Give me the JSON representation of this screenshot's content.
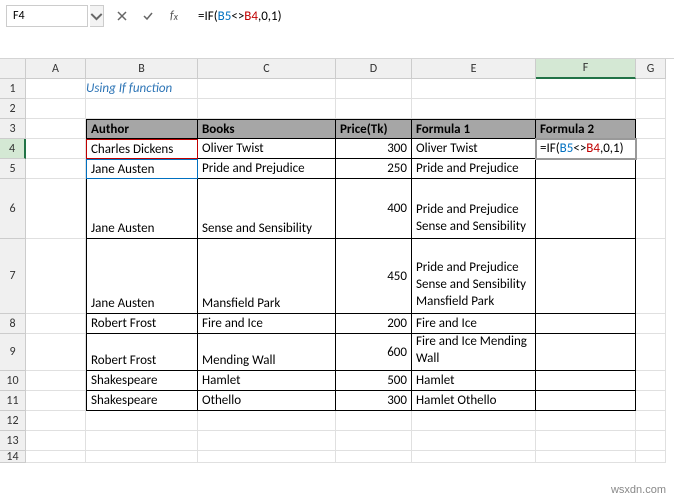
{
  "nameBox": "F4",
  "formula": "=IF(B5<>B4,0,1)",
  "formula_parts": {
    "prefix": "=IF(",
    "ref1": "B5",
    "op": "<>",
    "ref2": "B4",
    "suffix": ",0,1)"
  },
  "title": "Using If function",
  "columns": [
    "A",
    "B",
    "C",
    "D",
    "E",
    "F",
    "G"
  ],
  "activeCol": "F",
  "activeRow": 4,
  "rowHeights": {
    "1": 20,
    "2": 20,
    "3": 20,
    "4": 20,
    "5": 20,
    "6": 60,
    "7": 75,
    "8": 20,
    "9": 37,
    "10": 20,
    "11": 20,
    "12": 20,
    "13": 20,
    "14": 12
  },
  "headers": {
    "B": "Author",
    "C": "Books",
    "D": "Price(Tk)",
    "E": "Formula 1",
    "F": "Formula 2"
  },
  "rows": [
    {
      "r": 4,
      "author": "Charles Dickens",
      "book": "Oliver Twist",
      "price": "300",
      "f1": "Oliver Twist",
      "f2": "=IF(B5<>B4,0,1)"
    },
    {
      "r": 5,
      "author": "Jane Austen",
      "book": "Pride and Prejudice",
      "price": "250",
      "f1": "Pride and Prejudice",
      "f2": ""
    },
    {
      "r": 6,
      "author": "Jane Austen",
      "book": "Sense and Sensibility",
      "price": "400",
      "f1": "Pride and Prejudice Sense and Sensibility",
      "f2": ""
    },
    {
      "r": 7,
      "author": "Jane Austen",
      "book": "Mansfield Park",
      "price": "450",
      "f1": "Pride and Prejudice Sense and Sensibility Mansfield Park",
      "f2": ""
    },
    {
      "r": 8,
      "author": "Robert Frost",
      "book": "Fire and Ice",
      "price": "200",
      "f1": "Fire and Ice",
      "f2": ""
    },
    {
      "r": 9,
      "author": "Robert Frost",
      "book": "Mending Wall",
      "price": "600",
      "f1": "Fire and Ice Mending Wall",
      "f2": ""
    },
    {
      "r": 10,
      "author": "Shakespeare",
      "book": "Hamlet",
      "price": "500",
      "f1": "Hamlet",
      "f2": ""
    },
    {
      "r": 11,
      "author": "Shakespeare",
      "book": "Othello",
      "price": "300",
      "f1": "   Hamlet Othello",
      "f2": ""
    }
  ],
  "watermark": "wsxdn.com"
}
